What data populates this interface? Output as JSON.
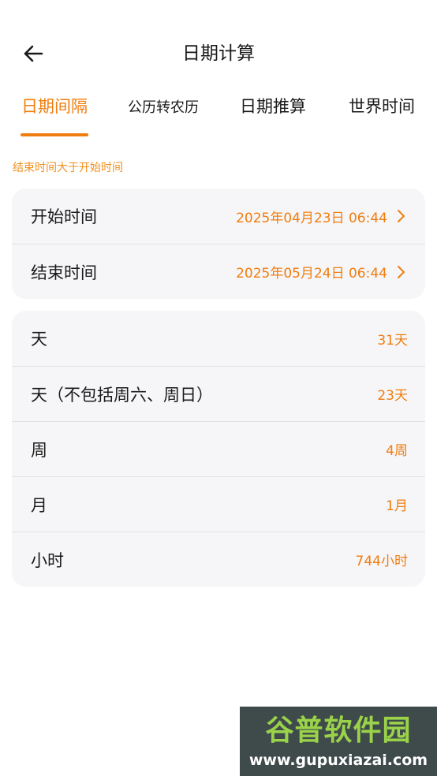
{
  "header": {
    "title": "日期计算",
    "back_icon": "arrow-left-icon"
  },
  "tabs": [
    {
      "label": "日期间隔",
      "active": true
    },
    {
      "label": "公历转农历",
      "active": false
    },
    {
      "label": "日期推算",
      "active": false
    },
    {
      "label": "世界时间",
      "active": false
    }
  ],
  "hint": "结束时间大于开始时间",
  "time_range": {
    "start": {
      "label": "开始时间",
      "value": "2025年04月23日 06:44"
    },
    "end": {
      "label": "结束时间",
      "value": "2025年05月24日 06:44"
    }
  },
  "results": [
    {
      "label": "天",
      "value": "31天"
    },
    {
      "label": "天（不包括周六、周日）",
      "value": "23天"
    },
    {
      "label": "周",
      "value": "4周"
    },
    {
      "label": "月",
      "value": "1月"
    },
    {
      "label": "小时",
      "value": "744小时"
    }
  ],
  "watermark": {
    "title": "谷普软件园",
    "url": "www.gupuxiazai.com"
  },
  "colors": {
    "accent": "#f07d0f",
    "card_bg": "#f6f6f8",
    "text": "#1a1a1a"
  }
}
